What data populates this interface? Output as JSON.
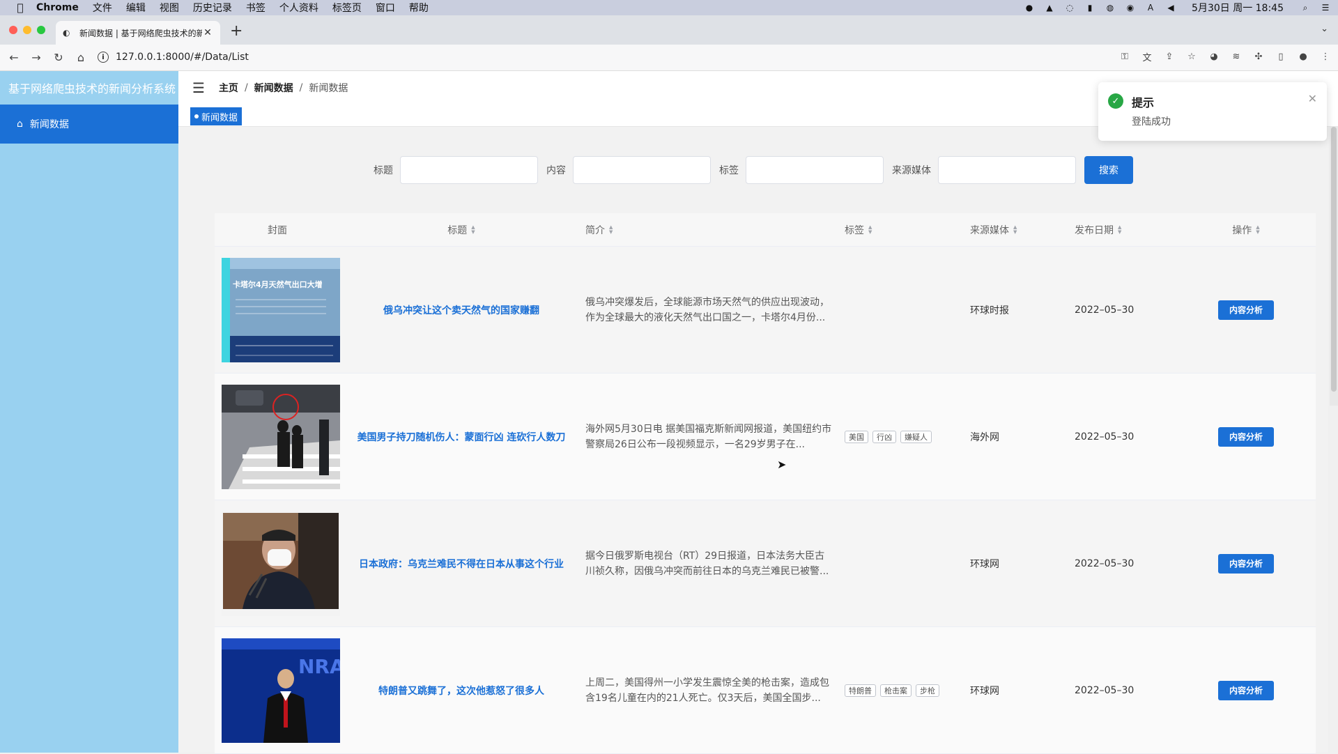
{
  "menubar": {
    "app_name": "Chrome",
    "items": [
      "文件",
      "编辑",
      "视图",
      "历史记录",
      "书签",
      "个人资料",
      "标签页",
      "窗口",
      "帮助"
    ],
    "clock": "5月30日 周一 18:45"
  },
  "browser": {
    "tab_title": "新闻数据 | 基于网络爬虫技术的新",
    "url": "127.0.0.1:8000/#/Data/List"
  },
  "sidebar": {
    "brand": "基于网络爬虫技术的新闻分析系统",
    "items": [
      {
        "label": "新闻数据",
        "icon": "home-icon"
      }
    ]
  },
  "breadcrumb": {
    "home": "主页",
    "section": "新闻数据",
    "current": "新闻数据",
    "separator": "/"
  },
  "tags_bar": {
    "active_tag": "新闻数据"
  },
  "search": {
    "title_label": "标题",
    "content_label": "内容",
    "tag_label": "标签",
    "media_label": "来源媒体",
    "button_label": "搜索"
  },
  "table": {
    "headers": {
      "cover": "封面",
      "title": "标题",
      "summary": "简介",
      "tags": "标签",
      "media": "来源媒体",
      "date": "发布日期",
      "op": "操作"
    },
    "rows": [
      {
        "title": "俄乌冲突让这个卖天然气的国家赚翻",
        "summary": "俄乌冲突爆发后，全球能源市场天然气的供应出现波动，作为全球最大的液化天然气出口国之一，卡塔尔4月份...",
        "tags": [],
        "media": "环球时报",
        "date": "2022–05–30",
        "op": "内容分析",
        "cover_caption": "卡塔尔4月天然气出口大增"
      },
      {
        "title": "美国男子持刀随机伤人：蒙面行凶 连砍行人数刀",
        "summary": "海外网5月30日电 据美国福克斯新闻网报道，美国纽约市警察局26日公布一段视频显示，一名29岁男子在...",
        "tags": [
          "美国",
          "行凶",
          "嫌疑人"
        ],
        "media": "海外网",
        "date": "2022–05–30",
        "op": "内容分析"
      },
      {
        "title": "日本政府：乌克兰难民不得在日本从事这个行业",
        "summary": "据今日俄罗斯电视台（RT）29日报道，日本法务大臣古川祯久称，因俄乌冲突而前往日本的乌克兰难民已被警...",
        "tags": [],
        "media": "环球网",
        "date": "2022–05–30",
        "op": "内容分析"
      },
      {
        "title": "特朗普又跳舞了，这次他惹怒了很多人",
        "summary": "上周二，美国得州一小学发生震惊全美的枪击案，造成包含19名儿童在内的21人死亡。仅3天后，美国全国步...",
        "tags": [
          "特朗普",
          "枪击案",
          "步枪"
        ],
        "media": "环球网",
        "date": "2022–05–30",
        "op": "内容分析",
        "cover_caption": "NRA"
      }
    ]
  },
  "toast": {
    "title": "提示",
    "message": "登陆成功"
  },
  "colors": {
    "primary": "#1b70d6",
    "sidebar": "#99d1f0",
    "success": "#28a745"
  }
}
